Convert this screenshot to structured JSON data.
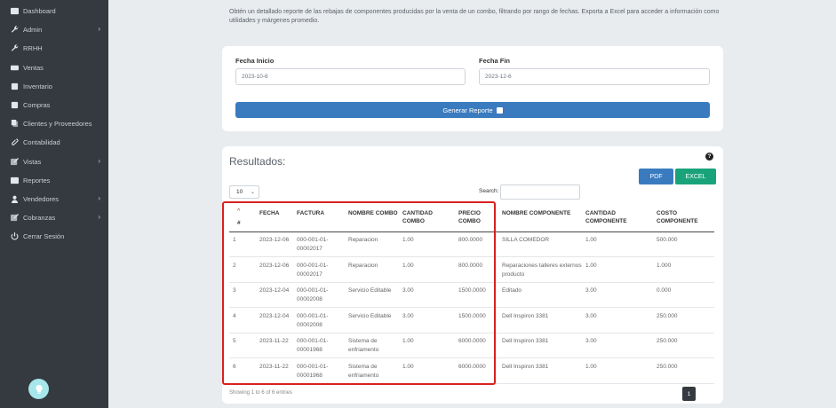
{
  "sidebar": {
    "items": [
      {
        "label": "Dashboard",
        "icon": "dashboard-icon",
        "chevron": false
      },
      {
        "label": "Admin",
        "icon": "wrench-icon",
        "chevron": true
      },
      {
        "label": "RRHH",
        "icon": "wrench-icon",
        "chevron": false
      },
      {
        "label": "Ventas",
        "icon": "money-icon",
        "chevron": false
      },
      {
        "label": "Inventario",
        "icon": "box-icon",
        "chevron": false
      },
      {
        "label": "Compras",
        "icon": "box-icon",
        "chevron": false
      },
      {
        "label": "Clientes y Proveedores",
        "icon": "copy-icon",
        "chevron": false
      },
      {
        "label": "Contabilidad",
        "icon": "paperclip-icon",
        "chevron": false
      },
      {
        "label": "Vistas",
        "icon": "edit-icon",
        "chevron": true
      },
      {
        "label": "Reportes",
        "icon": "list-icon",
        "chevron": false
      },
      {
        "label": "Vendedores",
        "icon": "user-icon",
        "chevron": true
      },
      {
        "label": "Cobranzas",
        "icon": "edit-icon",
        "chevron": true
      },
      {
        "label": "Cerrar Sesión",
        "icon": "power-icon",
        "chevron": false
      }
    ],
    "chevron_glyph": "›",
    "help_icon": "lightbulb-icon"
  },
  "intro_text": "Obtén un detallado reporte de las rebajas de componentes producidas por la venta de un combo, filtrando por rango de fechas. Exporta a Excel para acceder a información como utilidades y márgenes promedio.",
  "form": {
    "fecha_inicio_label": "Fecha Inicio",
    "fecha_inicio_value": "2023-10-6",
    "fecha_fin_label": "Fecha Fin",
    "fecha_fin_value": "2023-12-6",
    "generate_label": "Generar Reporte"
  },
  "results": {
    "title": "Resultados:",
    "help_glyph": "?",
    "pdf_label": "PDF",
    "excel_label": "EXCEL",
    "page_length": "10",
    "search_label": "Search:",
    "sort_glyph": "^",
    "columns": [
      {
        "key": "num",
        "label": "#"
      },
      {
        "key": "fecha",
        "label": "FECHA"
      },
      {
        "key": "factura",
        "label": "FACTURA"
      },
      {
        "key": "nombre_combo",
        "label": "NOMBRE COMBO"
      },
      {
        "key": "cantidad_combo",
        "label": "CANTIDAD COMBO"
      },
      {
        "key": "precio_combo",
        "label": "PRECIO COMBO"
      },
      {
        "key": "nombre_componente",
        "label": "NOMBRE COMPONENTE"
      },
      {
        "key": "cantidad_componente",
        "label": "CANTIDAD COMPONENTE"
      },
      {
        "key": "costo_componente",
        "label": "COSTO COMPONENTE"
      }
    ],
    "rows": [
      {
        "num": "1",
        "fecha": "2023-12-06",
        "factura": "000-001-01-00002017",
        "nombre_combo": "Reparacion",
        "cantidad_combo": "1.00",
        "precio_combo": "800.0000",
        "nombre_componente": "SILLA COMEDOR",
        "cantidad_componente": "1.00",
        "costo_componente": "500.000"
      },
      {
        "num": "2",
        "fecha": "2023-12-06",
        "factura": "000-001-01-00002017",
        "nombre_combo": "Reparacion",
        "cantidad_combo": "1.00",
        "precio_combo": "800.0000",
        "nombre_componente": "Reparaciones talleres externos producto",
        "cantidad_componente": "1.00",
        "costo_componente": "1.000"
      },
      {
        "num": "3",
        "fecha": "2023-12-04",
        "factura": "000-001-01-00002008",
        "nombre_combo": "Servicio Editable",
        "cantidad_combo": "3.00",
        "precio_combo": "1500.0000",
        "nombre_componente": "Editado",
        "cantidad_componente": "3.00",
        "costo_componente": "0.000"
      },
      {
        "num": "4",
        "fecha": "2023-12-04",
        "factura": "000-001-01-00002008",
        "nombre_combo": "Servicio Editable",
        "cantidad_combo": "3.00",
        "precio_combo": "1500.0000",
        "nombre_componente": "Dell Inspiron 3381",
        "cantidad_componente": "3.00",
        "costo_componente": "250.000"
      },
      {
        "num": "5",
        "fecha": "2023-11-22",
        "factura": "000-001-01-00001968",
        "nombre_combo": "Sistema de enfriamento",
        "cantidad_combo": "1.00",
        "precio_combo": "6000.0000",
        "nombre_componente": "Dell Inspiron 3381",
        "cantidad_componente": "3.00",
        "costo_componente": "250.000"
      },
      {
        "num": "6",
        "fecha": "2023-11-22",
        "factura": "000-001-01-00001968",
        "nombre_combo": "Sistema de enfriamento",
        "cantidad_combo": "1.00",
        "precio_combo": "6000.0000",
        "nombre_componente": "Dell Inspiron 3381",
        "cantidad_componente": "1.00",
        "costo_componente": "250.000"
      }
    ],
    "info_text": "Showing 1 to 6 of 6 entries",
    "current_page": "1"
  },
  "colors": {
    "sidebar_bg": "#343a40",
    "primary": "#3a7bbf",
    "excel": "#1aa37a",
    "highlight": "#d9211f"
  }
}
